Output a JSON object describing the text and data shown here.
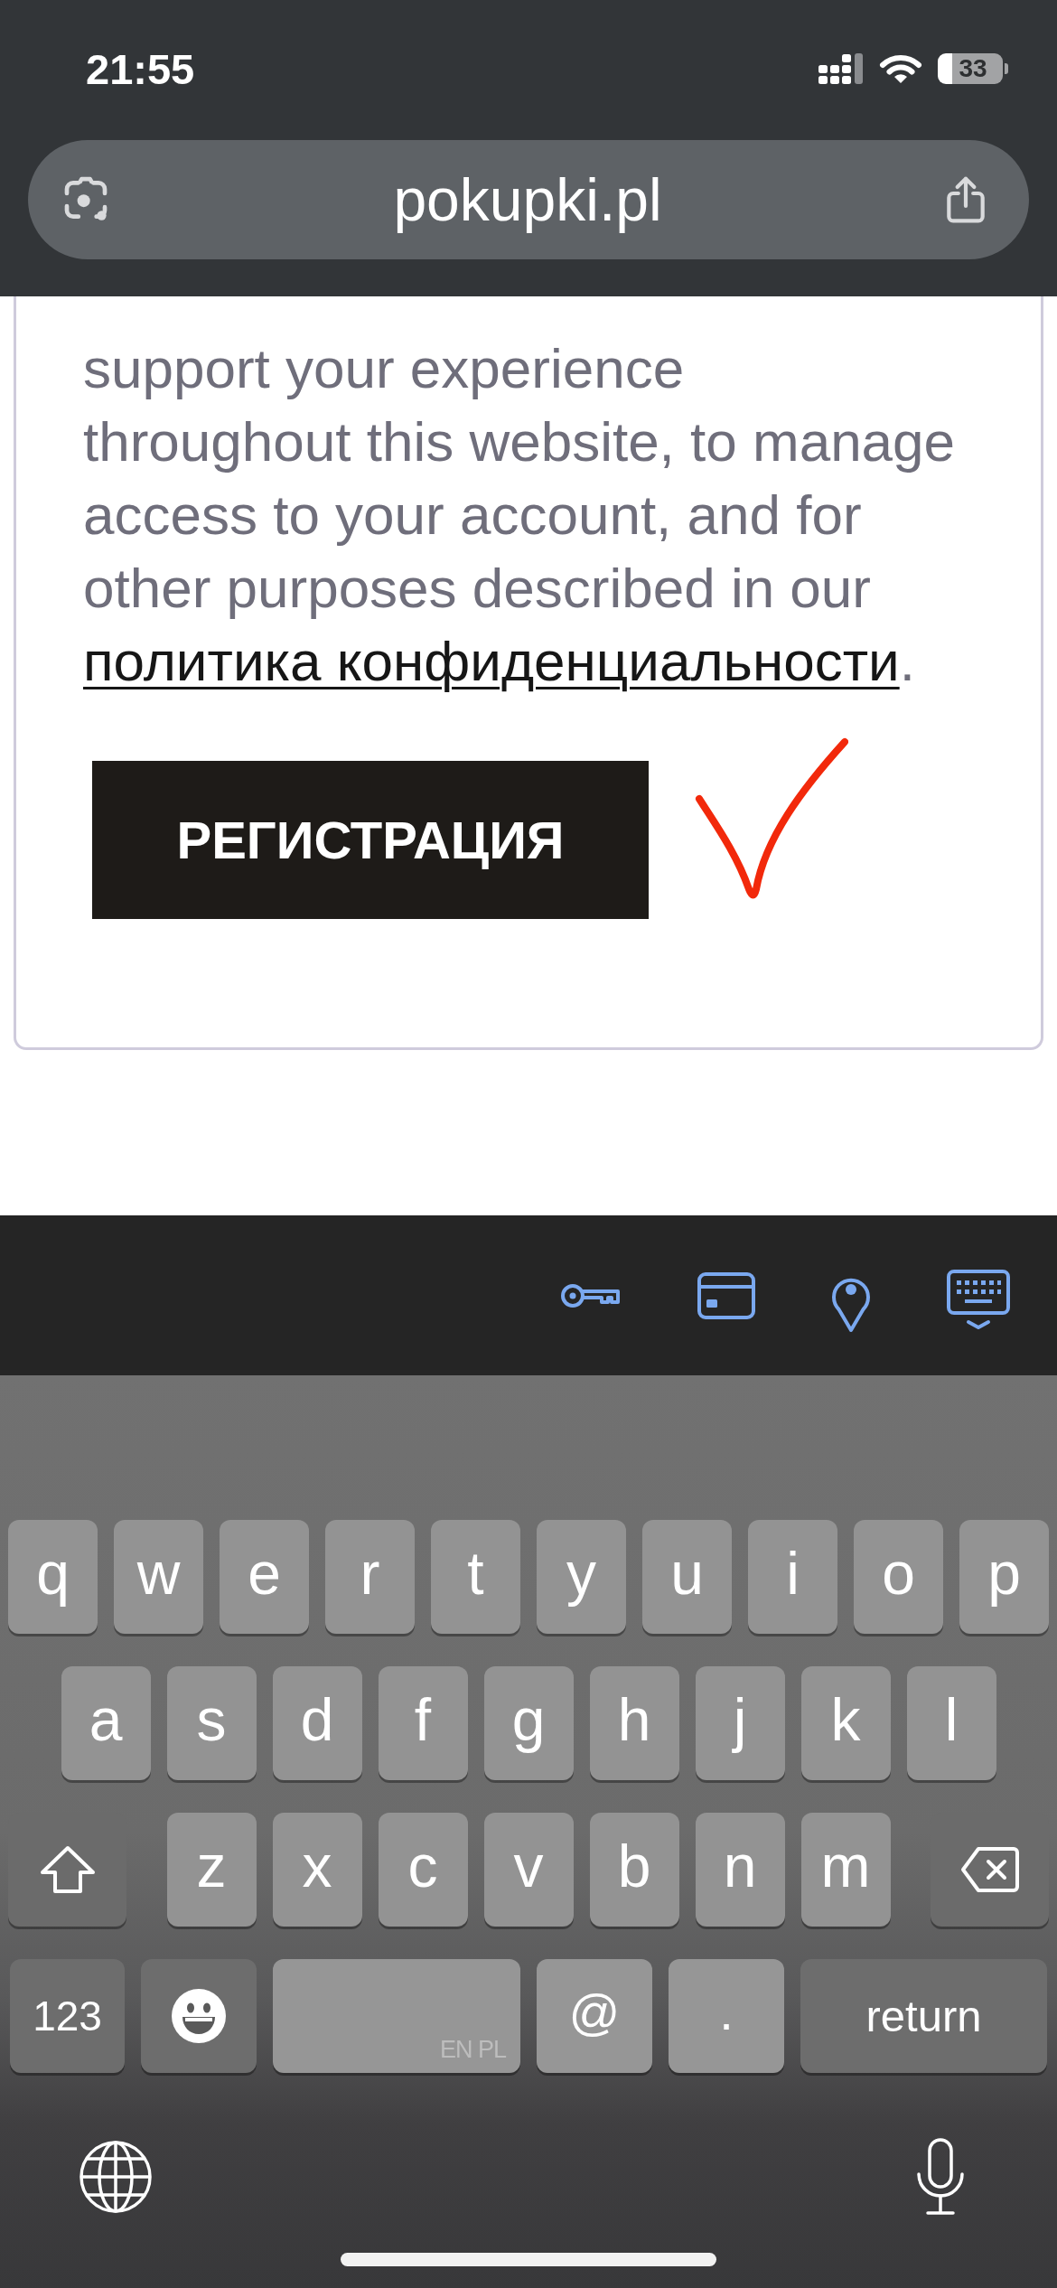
{
  "status_bar": {
    "time": "21:55",
    "battery": "33"
  },
  "address_bar": {
    "url": "pokupki.pl"
  },
  "form": {
    "consent_text": "support your experience throughout this website, to manage access to your account, and for other purposes described in our",
    "privacy_link": "политика конфиденциальности",
    "text_after_link": ".",
    "register_button": "РЕГИСТРАЦИЯ"
  },
  "keyboard": {
    "rows": [
      {
        "keys": [
          {
            "kind": "letter",
            "label": "q"
          },
          {
            "kind": "letter",
            "label": "w"
          },
          {
            "kind": "letter",
            "label": "e"
          },
          {
            "kind": "letter",
            "label": "r"
          },
          {
            "kind": "letter",
            "label": "t"
          },
          {
            "kind": "letter",
            "label": "y"
          },
          {
            "kind": "letter",
            "label": "u"
          },
          {
            "kind": "letter",
            "label": "i"
          },
          {
            "kind": "letter",
            "label": "o"
          },
          {
            "kind": "letter",
            "label": "p"
          }
        ]
      },
      {
        "keys": [
          {
            "kind": "letter",
            "label": "a"
          },
          {
            "kind": "letter",
            "label": "s"
          },
          {
            "kind": "letter",
            "label": "d"
          },
          {
            "kind": "letter",
            "label": "f"
          },
          {
            "kind": "letter",
            "label": "g"
          },
          {
            "kind": "letter",
            "label": "h"
          },
          {
            "kind": "letter",
            "label": "j"
          },
          {
            "kind": "letter",
            "label": "k"
          },
          {
            "kind": "letter",
            "label": "l"
          }
        ]
      },
      {
        "keys": [
          {
            "kind": "shift"
          },
          {
            "kind": "letter",
            "label": "z"
          },
          {
            "kind": "letter",
            "label": "x"
          },
          {
            "kind": "letter",
            "label": "c"
          },
          {
            "kind": "letter",
            "label": "v"
          },
          {
            "kind": "letter",
            "label": "b"
          },
          {
            "kind": "letter",
            "label": "n"
          },
          {
            "kind": "letter",
            "label": "m"
          },
          {
            "kind": "delete"
          }
        ]
      },
      {
        "keys": [
          {
            "kind": "mode",
            "label": "123"
          },
          {
            "kind": "emoji"
          },
          {
            "kind": "space",
            "label": "EN PL"
          },
          {
            "kind": "symbol",
            "label": "@"
          },
          {
            "kind": "symbol",
            "label": "."
          },
          {
            "kind": "return",
            "label": "return"
          }
        ]
      }
    ]
  }
}
